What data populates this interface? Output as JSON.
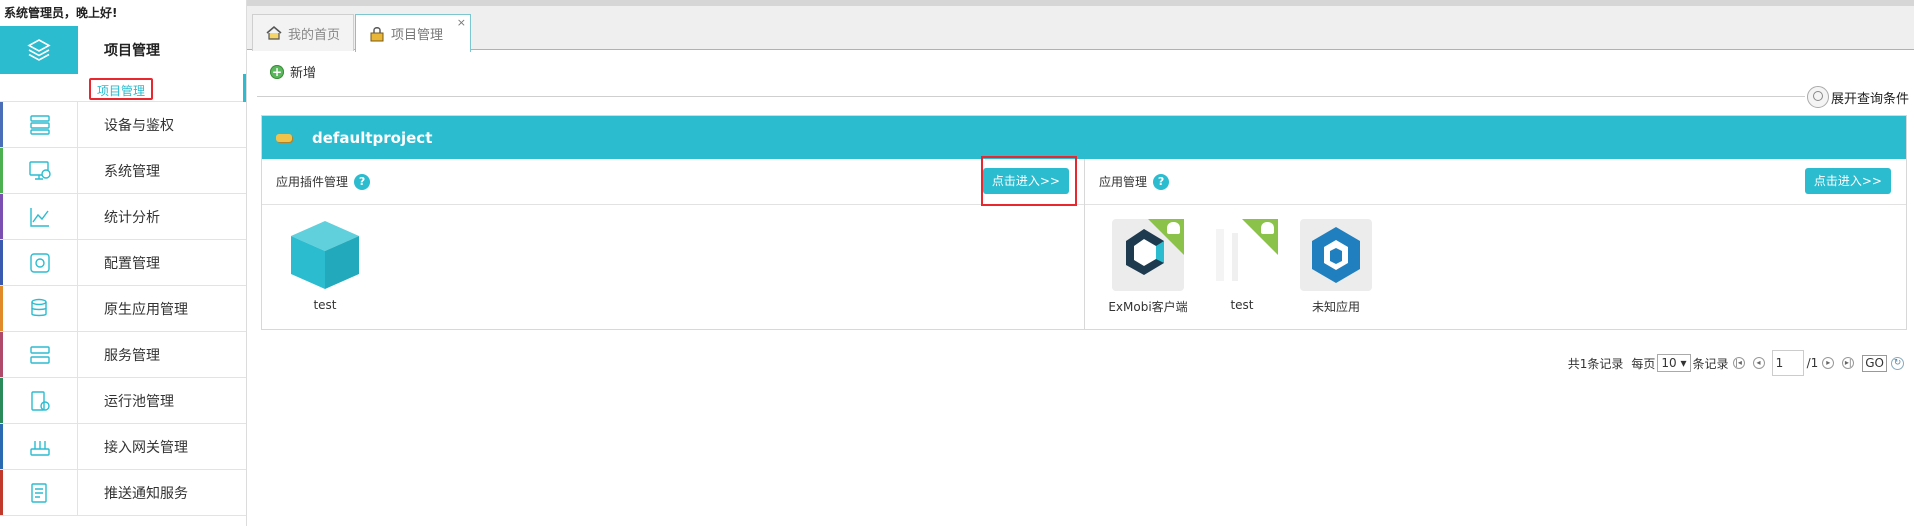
{
  "greeting": "系统管理员，晚上好!",
  "sidebar": {
    "active": {
      "label": "项目管理",
      "sub_label": "项目管理",
      "icon": "layers-icon"
    },
    "items": [
      {
        "label": "设备与鉴权",
        "icon": "server-icon",
        "color": "#4a6fb8"
      },
      {
        "label": "系统管理",
        "icon": "monitor-icon",
        "color": "#4caf50"
      },
      {
        "label": "统计分析",
        "icon": "chart-icon",
        "color": "#7b4fb2"
      },
      {
        "label": "配置管理",
        "icon": "gear-icon",
        "color": "#3a5ab0"
      },
      {
        "label": "原生应用管理",
        "icon": "database-icon",
        "color": "#e08a2a"
      },
      {
        "label": "服务管理",
        "icon": "services-icon",
        "color": "#b04a6a"
      },
      {
        "label": "运行池管理",
        "icon": "pool-icon",
        "color": "#2a8a5a"
      },
      {
        "label": "接入网关管理",
        "icon": "router-icon",
        "color": "#2a6ab0"
      },
      {
        "label": "推送通知服务",
        "icon": "notification-icon",
        "color": "#c0392b"
      }
    ]
  },
  "tabs": [
    {
      "label": "我的首页",
      "icon": "home-icon"
    },
    {
      "label": "项目管理",
      "icon": "lock-icon",
      "close": "×"
    }
  ],
  "toolbar": {
    "add_label": "新增",
    "expand_search_label": "展开查询条件"
  },
  "project": {
    "name": "defaultproject",
    "left": {
      "title": "应用插件管理",
      "enter_label": "点击进入>>",
      "apps": [
        {
          "name": "test",
          "icon": "cube-icon"
        }
      ]
    },
    "right": {
      "title": "应用管理",
      "enter_label": "点击进入>>",
      "apps": [
        {
          "name": "ExMobi客户端",
          "icon": "exmobi-icon"
        },
        {
          "name": "test",
          "icon": "blank-app-icon"
        },
        {
          "name": "未知应用",
          "icon": "unknown-app-icon"
        }
      ]
    }
  },
  "pager": {
    "total_label": "共1条记录",
    "per_page_prefix": "每页",
    "per_page_value": "10",
    "per_page_suffix": "条记录",
    "current_page": "1",
    "total_pages": "/1",
    "go_label": "GO"
  },
  "colors": {
    "accent": "#2bbcd0",
    "highlight": "#e8272f",
    "android_badge": "#8bc34a"
  }
}
